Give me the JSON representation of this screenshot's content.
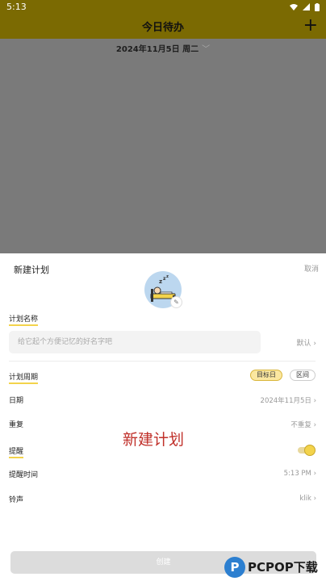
{
  "status_bar": {
    "time": "5:13"
  },
  "app_bar": {
    "title": "今日待办",
    "add_glyph": "+"
  },
  "date_header": {
    "date": "2024年11月5日 周二",
    "chevron": "﹀"
  },
  "sheet": {
    "title": "新建计划",
    "cancel": "取消",
    "avatar_icon": "sleeping-in-bed-icon",
    "name_section": {
      "label": "计划名称",
      "placeholder": "给它起个方便记忆的好名字吧",
      "default_link": "默认 ›"
    },
    "period_section": {
      "label": "计划周期",
      "chips": [
        {
          "label": "目标日",
          "active": true
        },
        {
          "label": "区间",
          "active": false
        }
      ]
    },
    "rows": {
      "date": {
        "label": "日期",
        "value": "2024年11月5日 ›"
      },
      "repeat": {
        "label": "重复",
        "value": "不重复 ›"
      },
      "reminder_label": "提醒",
      "reminder_time": {
        "label": "提醒时间",
        "value": "5:13 PM ›"
      },
      "ringtone": {
        "label": "铃声",
        "value": "klik ›"
      }
    },
    "reminder_on": true,
    "watermark": "新建计划",
    "create_button": "创建"
  },
  "logo": {
    "mark": "P",
    "name": "PCPOP下载"
  },
  "colors": {
    "appbar": "#7b6a02",
    "accent": "#f3d34b",
    "overlay": "#7a7a7a",
    "watermark": "#c0302a"
  }
}
